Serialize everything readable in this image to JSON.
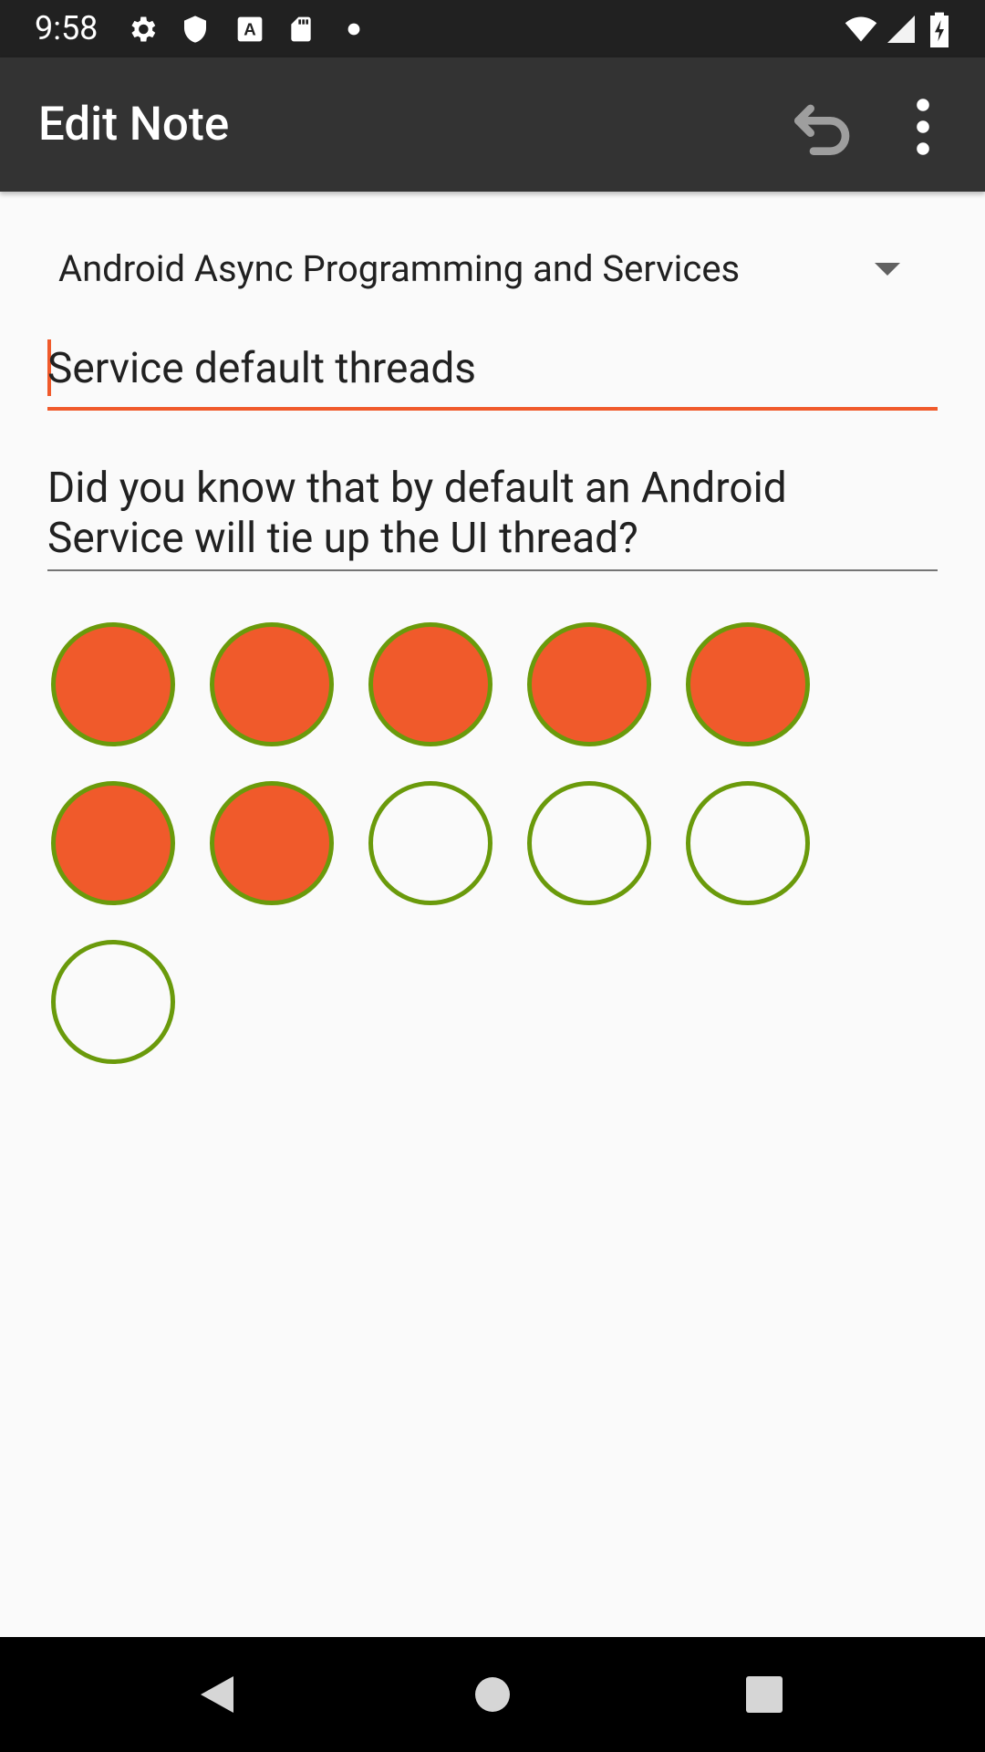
{
  "status_bar": {
    "time": "9:58",
    "left_icons": [
      "gear-icon",
      "shield-icon",
      "a-notification-icon",
      "sd-card-icon",
      "dot-icon"
    ],
    "right_icons": [
      "wifi-icon",
      "signal-icon",
      "battery-charging-icon"
    ]
  },
  "app_bar": {
    "title": "Edit Note",
    "actions": [
      "undo-icon",
      "overflow-menu-icon"
    ]
  },
  "form": {
    "course_selected": "Android Async Programming and Services",
    "note_title": "Service default threads",
    "note_text": "Did you know that by default an Android Service will tie up the UI thread?"
  },
  "progress": {
    "filled_count": 7,
    "total_count": 11,
    "filled_color": "#f05a2b",
    "border_color": "#6a9a0b"
  },
  "nav_bar": {
    "buttons": [
      "back-icon",
      "home-icon",
      "recents-icon"
    ]
  },
  "colors": {
    "accent": "#f05a2b",
    "app_bar": "#333333",
    "status_bar": "#212121"
  }
}
